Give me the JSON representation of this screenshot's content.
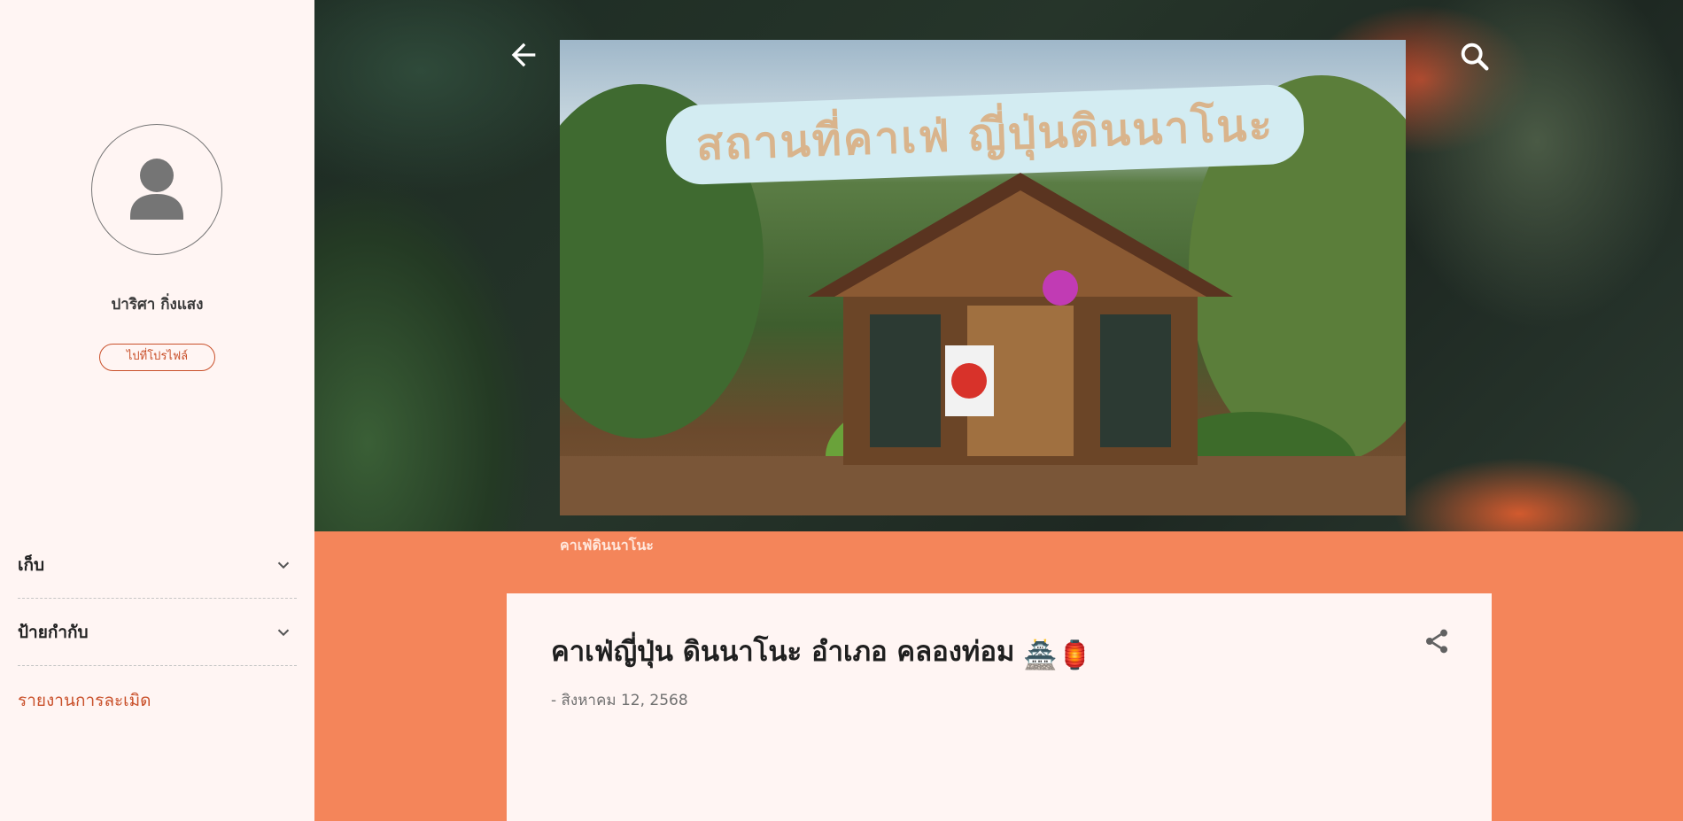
{
  "sidebar": {
    "profile": {
      "name": "ปาริศา กิ่งแสง",
      "button_label": "ไปที่โปรไฟล์",
      "avatar_icon": "person-icon"
    },
    "nav": [
      {
        "label": "เก็บ",
        "icon": "chevron-down-icon"
      },
      {
        "label": "ป้ายกำกับ",
        "icon": "chevron-down-icon"
      }
    ],
    "report_link": "รายงานการละเมิด"
  },
  "header": {
    "back_icon": "arrow-left-icon",
    "search_icon": "search-icon",
    "blog_title": "คาเฟ่ดินนาโนะ",
    "hero_sign_text": "สถานที่คาเฟ่ ญี่ปุ่นดินนาโนะ"
  },
  "post": {
    "title": "คาเฟ่ญี่ปุ่น ดินนาโนะ อำเภอ คลองท่อม",
    "title_emojis": "🏯🏮",
    "date": "- สิงหาคม 12, 2568",
    "share_icon": "share-icon"
  },
  "colors": {
    "accent": "#c9502a",
    "page_background": "#f4855a",
    "sidebar_background": "#fff5f3"
  }
}
